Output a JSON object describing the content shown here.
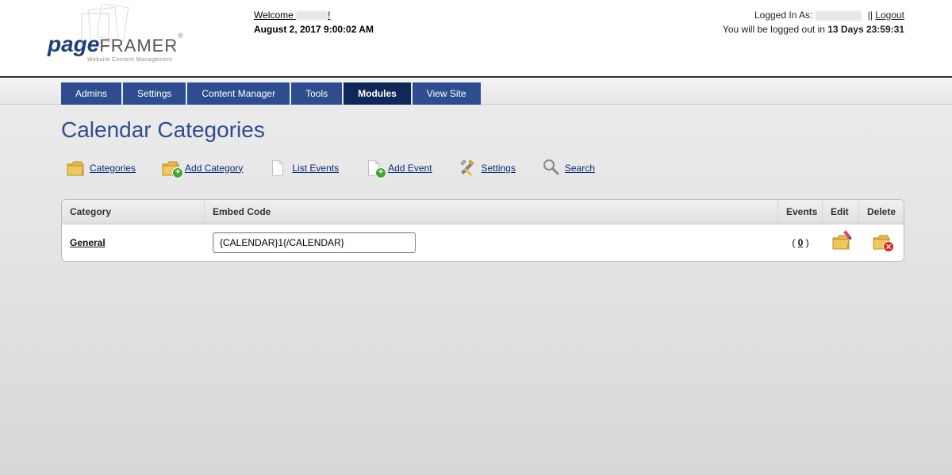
{
  "header": {
    "welcome_prefix": "Welcome",
    "welcome_suffix": "!",
    "date": "August 2, 2017 9:00:02 AM",
    "logged_in_label": "Logged In As:",
    "separator": " || ",
    "logout_label": "Logout",
    "logout_warning_prefix": "You will be logged out in ",
    "logout_countdown": "13 Days 23:59:31"
  },
  "logo": {
    "brand1": "page",
    "brand2": "FRAMER",
    "subtitle": "Website Content Management"
  },
  "nav": {
    "items": [
      {
        "label": "Admins",
        "active": false
      },
      {
        "label": "Settings",
        "active": false
      },
      {
        "label": "Content Manager",
        "active": false
      },
      {
        "label": "Tools",
        "active": false
      },
      {
        "label": "Modules",
        "active": true
      },
      {
        "label": "View Site",
        "active": false
      }
    ]
  },
  "page": {
    "title": "Calendar Categories"
  },
  "toolbar": {
    "categories": "Categories",
    "add_category": "Add Category",
    "list_events": "List Events",
    "add_event": "Add Event",
    "settings": "Settings",
    "search": "Search"
  },
  "table": {
    "headers": {
      "category": "Category",
      "embed": "Embed Code",
      "events": "Events",
      "edit": "Edit",
      "delete": "Delete"
    },
    "rows": [
      {
        "category": "General",
        "embed_code": "{CALENDAR}1{/CALENDAR}",
        "events_count": "0"
      }
    ]
  }
}
